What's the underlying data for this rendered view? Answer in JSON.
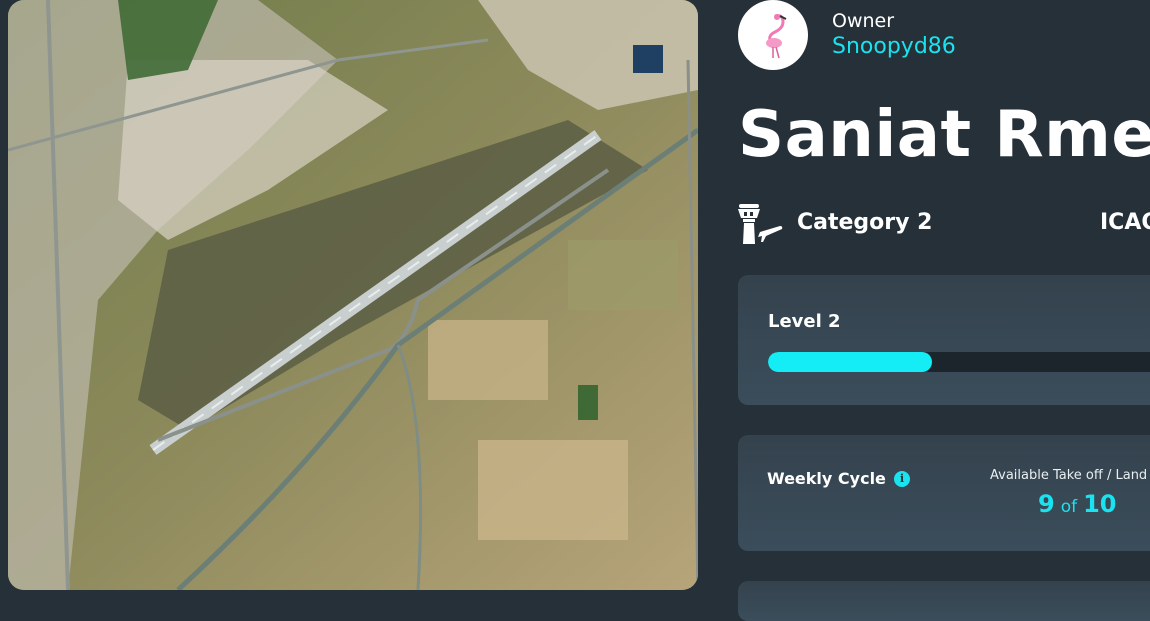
{
  "owner": {
    "label": "Owner",
    "name": "Snoopyd86",
    "avatar_icon": "flamingo-icon"
  },
  "airport": {
    "name": "Saniat Rmel",
    "category": "Category 2",
    "icao_label": "ICAO",
    "icon": "control-tower-icon"
  },
  "map": {
    "icon": "satellite-map"
  },
  "level": {
    "label": "Level 2",
    "progress": 0.39
  },
  "weekly": {
    "label": "Weekly Cycle",
    "info_icon": "info-icon",
    "available_label": "Available Take off / Land",
    "available": "9",
    "of": "of",
    "total": "10"
  },
  "colors": {
    "accent": "#19e3ef",
    "background": "#253038",
    "card": "#34424d"
  }
}
